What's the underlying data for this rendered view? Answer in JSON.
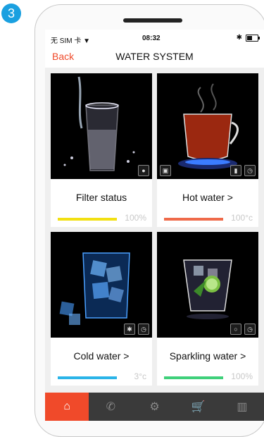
{
  "step_badge": "3",
  "status_bar": {
    "carrier": "无 SIM 卡",
    "time": "08:32"
  },
  "nav": {
    "back_label": "Back",
    "title": "WATER SYSTEM"
  },
  "cards": [
    {
      "label": "Filter status",
      "value": "100%",
      "bar_color": "#f2e012"
    },
    {
      "label": "Hot water >",
      "value": "100°c",
      "bar_color": "#ef6a4a"
    },
    {
      "label": "Cold water >",
      "value": "3°c",
      "bar_color": "#2ab4e8"
    },
    {
      "label": "Sparkling water >",
      "value": "100%",
      "bar_color": "#3fd07a"
    }
  ],
  "icons": {
    "battery": "battery-icon",
    "bluetooth": "bluetooth-icon",
    "wifi": "wifi-icon"
  },
  "tabs": [
    {
      "icon": "home-icon",
      "glyph": "⌂",
      "active": true
    },
    {
      "icon": "phone-icon",
      "glyph": "✆",
      "active": false
    },
    {
      "icon": "settings-icon",
      "glyph": "⚙",
      "active": false
    },
    {
      "icon": "cart-icon",
      "glyph": "🛒",
      "active": false
    },
    {
      "icon": "chart-icon",
      "glyph": "▥",
      "active": false
    }
  ],
  "accent_color": "#f04a2a"
}
